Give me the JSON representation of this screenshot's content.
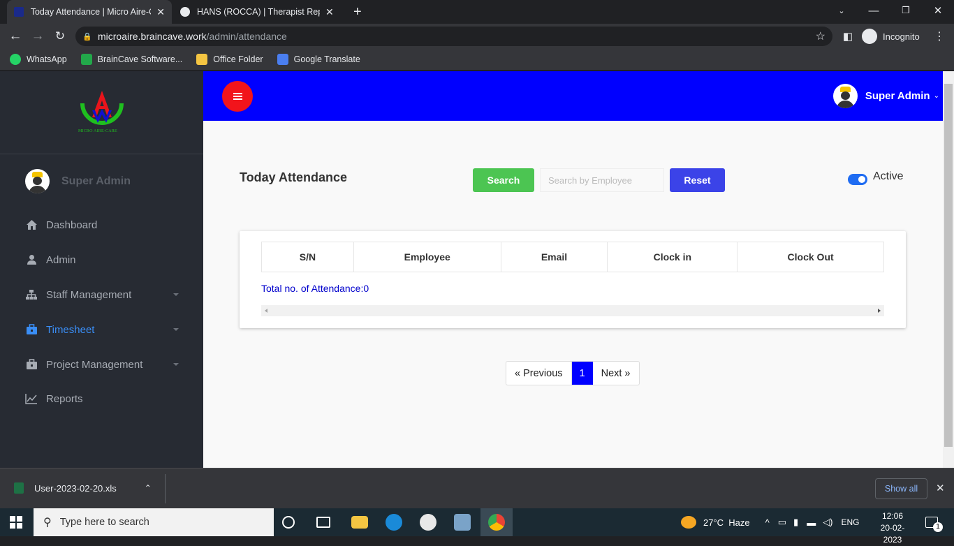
{
  "browser": {
    "tabs": [
      {
        "title": "Today Attendance | Micro Aire-Care",
        "active": true
      },
      {
        "title": "HANS (ROCCA) | Therapist Report",
        "active": false
      }
    ],
    "url_host": "microaire.braincave.work",
    "url_path": "/admin/attendance",
    "incognito_label": "Incognito",
    "bookmarks": [
      "WhatsApp",
      "BrainCave Software...",
      "Office Folder",
      "Google Translate"
    ]
  },
  "sidebar": {
    "logo_text": "MICRO AIRE-CARE",
    "user_name": "Super Admin",
    "items": [
      {
        "label": "Dashboard",
        "icon": "home-icon",
        "active": false,
        "has_caret": false
      },
      {
        "label": "Admin",
        "icon": "user-icon",
        "active": false,
        "has_caret": false
      },
      {
        "label": "Staff Management",
        "icon": "sitemap-icon",
        "active": false,
        "has_caret": true
      },
      {
        "label": "Timesheet",
        "icon": "briefcase-icon",
        "active": true,
        "has_caret": true
      },
      {
        "label": "Project Management",
        "icon": "briefcase-icon",
        "active": false,
        "has_caret": true
      },
      {
        "label": "Reports",
        "icon": "chart-line-icon",
        "active": false,
        "has_caret": false
      }
    ]
  },
  "topbar": {
    "user_name": "Super Admin",
    "color": "#0000ff",
    "menu_button_color": "#f2141b"
  },
  "main": {
    "title": "Today Attendance",
    "search_label": "Search",
    "search_placeholder": "Search by Employee",
    "reset_label": "Reset",
    "toggle_label": "Active",
    "toggle_on": true,
    "table_headers": [
      "S/N",
      "Employee",
      "Email",
      "Clock in",
      "Clock Out"
    ],
    "total_text": "Total no. of Attendance:0",
    "pagination": {
      "prev": "« Previous",
      "current": "1",
      "next": "Next »"
    }
  },
  "downloads": {
    "file_name": "User-2023-02-20.xls",
    "show_all": "Show all"
  },
  "taskbar": {
    "search_placeholder": "Type here to search",
    "weather": "27°C  Haze",
    "language": "ENG",
    "time": "12:06",
    "date": "20-02-2023",
    "notification_count": "1"
  }
}
